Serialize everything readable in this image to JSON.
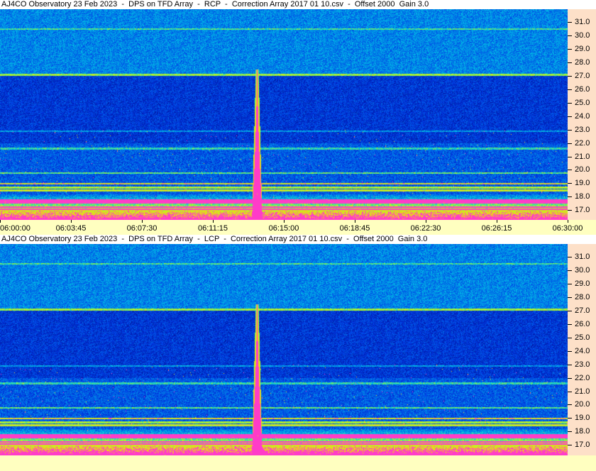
{
  "panels": [
    {
      "title": "AJ4CO Observatory 23 Feb 2023  -  DPS on TFD Array  -  RCP  -  Correction Array 2017 01 10.csv  -  Offset 2000  Gain 3.0",
      "polarization": "RCP"
    },
    {
      "title": "AJ4CO Observatory 23 Feb 2023  -  DPS on TFD Array  -  LCP  -  Correction Array 2017 01 10.csv  -  Offset 2000  Gain 3.0",
      "polarization": "LCP"
    }
  ],
  "freq_axis": {
    "unit": "MHz",
    "ticks": [
      "31.0",
      "30.0",
      "29.0",
      "28.0",
      "27.0",
      "26.0",
      "25.0",
      "24.0",
      "23.0",
      "22.0",
      "21.0",
      "20.0",
      "19.0",
      "18.0",
      "17.0"
    ]
  },
  "time_axis": {
    "ticks": [
      "06:00:00",
      "06:03:45",
      "06:07:30",
      "06:11:15",
      "06:15:00",
      "06:18:45",
      "06:22:30",
      "06:26:15",
      "06:30:00"
    ]
  },
  "colors": {
    "freq_axis_bg": "#fde0c8",
    "time_axis_bg": "#ffffc0",
    "spectrogram_base": "#1a4fe0"
  }
}
